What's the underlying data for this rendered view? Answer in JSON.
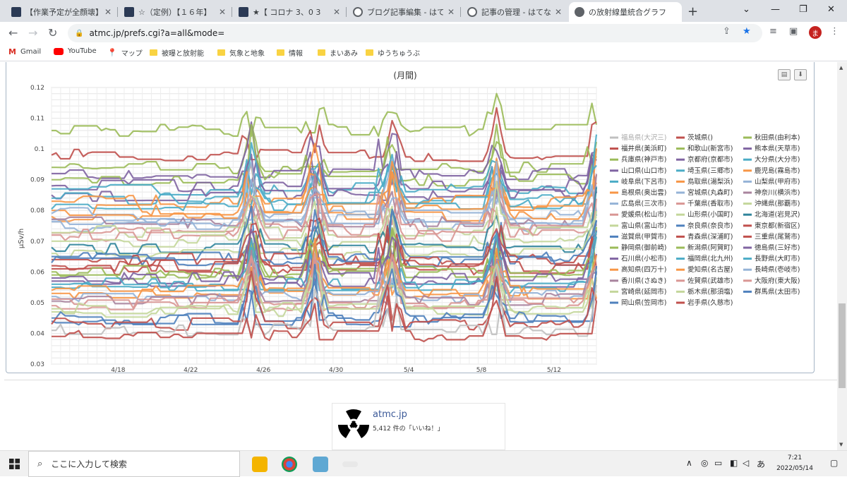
{
  "browser": {
    "tabs": [
      {
        "title": "【作業予定が全顔壊】 ",
        "favicon": "dark-square-icon",
        "active": false
      },
      {
        "title": "☆（定例）【１６年】",
        "favicon": "dark-square-icon",
        "active": false
      },
      {
        "title": "★【 コロナ 3、0 3",
        "favicon": "dark-square-icon",
        "active": false
      },
      {
        "title": "ブログ記事編集 - はてな",
        "favicon": "hatena-icon",
        "active": false
      },
      {
        "title": "記事の管理 - はてなブロ",
        "favicon": "hatena-icon",
        "active": false
      },
      {
        "title": "の放射線量統合グラフ",
        "favicon": "globe-icon",
        "active": true
      }
    ],
    "url": "atmc.jp/prefs.cgi?a=all&mode=",
    "avatar_letter": "ま",
    "bookmarks": [
      {
        "label": "Gmail",
        "icon": "gmail-icon"
      },
      {
        "label": "YouTube",
        "icon": "youtube-icon"
      },
      {
        "label": "マップ",
        "icon": "maps-icon"
      },
      {
        "label": "被曝と放射能",
        "icon": "folder-icon"
      },
      {
        "label": "気象と地象",
        "icon": "folder-icon"
      },
      {
        "label": "情報",
        "icon": "folder-icon"
      },
      {
        "label": "まいあみ",
        "icon": "folder-icon"
      },
      {
        "label": "ゆうちゅうぶ",
        "icon": "folder-icon"
      }
    ]
  },
  "chart_data": {
    "type": "line",
    "title": "(月間)",
    "ylabel": "μSv/h",
    "xlabel": "",
    "ylim": [
      0.03,
      0.12
    ],
    "yticks": [
      "0.12",
      "0.11",
      "0.1",
      "0.09",
      "0.08",
      "0.07",
      "0.06",
      "0.05",
      "0.04",
      "0.03"
    ],
    "xticks": [
      "4/18",
      "4/22",
      "4/26",
      "4/30",
      "5/4",
      "5/8",
      "5/12"
    ],
    "grid": true,
    "legend_position": "right",
    "legend": [
      {
        "name": "福島県(大沢三)",
        "color": "#c0c0c0"
      },
      {
        "name": "茨城県()",
        "color": "#c0504d"
      },
      {
        "name": "秋田県(由利本)",
        "color": "#9bbb59"
      },
      {
        "name": "福井県(美浜町)",
        "color": "#c0504d"
      },
      {
        "name": "和歌山(新宮市)",
        "color": "#9bbb59"
      },
      {
        "name": "熊本県(天草市)",
        "color": "#8064a2"
      },
      {
        "name": "兵庫県(神戸市)",
        "color": "#9bbb59"
      },
      {
        "name": "京都府(京都市)",
        "color": "#8064a2"
      },
      {
        "name": "大分県(大分市)",
        "color": "#4bacc6"
      },
      {
        "name": "山口県(山口市)",
        "color": "#8064a2"
      },
      {
        "name": "埼玉県(三郷市)",
        "color": "#4bacc6"
      },
      {
        "name": "鹿児島(霧島市)",
        "color": "#f79646"
      },
      {
        "name": "岐阜県(下呂市)",
        "color": "#4bacc6"
      },
      {
        "name": "鳥取県(湯梨浜)",
        "color": "#f79646"
      },
      {
        "name": "山梨県(甲府市)",
        "color": "#95b3d7"
      },
      {
        "name": "島根県(奥出雲)",
        "color": "#f79646"
      },
      {
        "name": "宮城県(丸森町)",
        "color": "#95b3d7"
      },
      {
        "name": "神奈川(横浜市)",
        "color": "#a9849e"
      },
      {
        "name": "広島県(三次市)",
        "color": "#95b3d7"
      },
      {
        "name": "千葉県(香取市)",
        "color": "#d99694"
      },
      {
        "name": "沖縄県(那覇市)",
        "color": "#c4d79b"
      },
      {
        "name": "愛媛県(松山市)",
        "color": "#d99694"
      },
      {
        "name": "山形県(小国町)",
        "color": "#c4d79b"
      },
      {
        "name": "北海道(岩見沢)",
        "color": "#31859c"
      },
      {
        "name": "富山県(富山市)",
        "color": "#c4d79b"
      },
      {
        "name": "奈良県(奈良市)",
        "color": "#4f81bd"
      },
      {
        "name": "東京都(新宿区)",
        "color": "#c0504d"
      },
      {
        "name": "滋賀県(甲賀市)",
        "color": "#4f81bd"
      },
      {
        "name": "青森県(深浦町)",
        "color": "#c0504d"
      },
      {
        "name": "三重県(尾鷲市)",
        "color": "#c0504d"
      },
      {
        "name": "静岡県(御前崎)",
        "color": "#9bbb59"
      },
      {
        "name": "新潟県(阿賀町)",
        "color": "#9bbb59"
      },
      {
        "name": "徳島県(三好市)",
        "color": "#8064a2"
      },
      {
        "name": "石川県(小松市)",
        "color": "#8064a2"
      },
      {
        "name": "福岡県(北九州)",
        "color": "#4bacc6"
      },
      {
        "name": "長野県(大町市)",
        "color": "#4bacc6"
      },
      {
        "name": "高知県(四万十)",
        "color": "#f79646"
      },
      {
        "name": "愛知県(名古屋)",
        "color": "#f79646"
      },
      {
        "name": "長崎県(壱岐市)",
        "color": "#95b3d7"
      },
      {
        "name": "香川県(さぬき)",
        "color": "#a9849e"
      },
      {
        "name": "佐賀県(武雄市)",
        "color": "#d99694"
      },
      {
        "name": "大阪府(東大阪)",
        "color": "#d99694"
      },
      {
        "name": "宮崎県(延岡市)",
        "color": "#c4d79b"
      },
      {
        "name": "栃木県(那須塩)",
        "color": "#c4d79b"
      },
      {
        "name": "群馬県(太田市)",
        "color": "#4f81bd"
      },
      {
        "name": "岡山県(笠岡市)",
        "color": "#4f81bd"
      },
      {
        "name": "岩手県(久慈市)",
        "color": "#c0504d"
      }
    ],
    "series_levels": [
      0.106,
      0.098,
      0.094,
      0.092,
      0.09,
      0.088,
      0.087,
      0.085,
      0.084,
      0.083,
      0.082,
      0.08,
      0.079,
      0.078,
      0.077,
      0.076,
      0.075,
      0.074,
      0.073,
      0.072,
      0.07,
      0.068,
      0.066,
      0.065,
      0.064,
      0.063,
      0.062,
      0.061,
      0.06,
      0.059,
      0.058,
      0.057,
      0.056,
      0.055,
      0.054,
      0.053,
      0.052,
      0.051,
      0.05,
      0.049,
      0.048,
      0.047,
      0.045,
      0.044,
      0.043,
      0.041,
      0.039
    ]
  },
  "widget": {
    "site": "atmc.jp",
    "likes": "5,412 件の「いいね！」"
  },
  "taskbar": {
    "search_placeholder": "ここに入力して検索",
    "ime": "あ",
    "time": "7:21",
    "date": "2022/05/14"
  }
}
